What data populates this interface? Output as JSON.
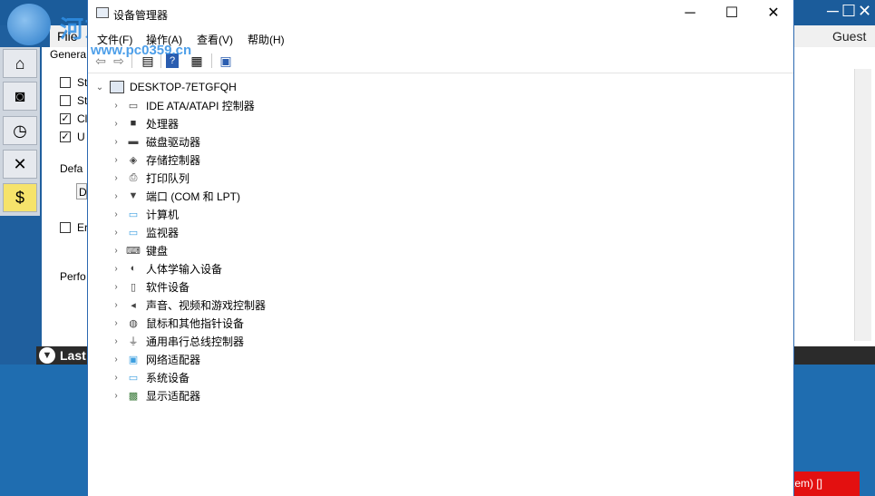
{
  "background_app": {
    "menu_file": "File",
    "tab_label": "Genera",
    "checks": [
      {
        "label": "St",
        "checked": false
      },
      {
        "label": "St",
        "checked": false
      },
      {
        "label": "Cl",
        "checked": true
      },
      {
        "label": "U",
        "checked": true
      }
    ],
    "default_label": "Defa",
    "dropdown_initial": "D",
    "enable_label": "Er",
    "perf_label": "Perfo",
    "guest_label": "Guest",
    "status_text": "Last",
    "red_task_text": "tem) []"
  },
  "watermark": {
    "title": "河东软件园",
    "url": "www.pc0359.cn"
  },
  "device_manager": {
    "title": "设备管理器",
    "controls": {
      "minimize": "─",
      "maximize": "☐",
      "close": "✕"
    },
    "menu": [
      "文件(F)",
      "操作(A)",
      "查看(V)",
      "帮助(H)"
    ],
    "root": "DESKTOP-7ETGFQH",
    "categories": [
      {
        "label": "IDE ATA/ATAPI 控制器",
        "icon": "ide-controller-icon"
      },
      {
        "label": "处理器",
        "icon": "processor-icon"
      },
      {
        "label": "磁盘驱动器",
        "icon": "disk-drive-icon"
      },
      {
        "label": "存储控制器",
        "icon": "storage-controller-icon"
      },
      {
        "label": "打印队列",
        "icon": "printer-icon"
      },
      {
        "label": "端口 (COM 和 LPT)",
        "icon": "port-icon"
      },
      {
        "label": "计算机",
        "icon": "computer-icon"
      },
      {
        "label": "监视器",
        "icon": "monitor-icon"
      },
      {
        "label": "键盘",
        "icon": "keyboard-icon"
      },
      {
        "label": "人体学输入设备",
        "icon": "hid-icon"
      },
      {
        "label": "软件设备",
        "icon": "software-device-icon"
      },
      {
        "label": "声音、视频和游戏控制器",
        "icon": "audio-icon"
      },
      {
        "label": "鼠标和其他指针设备",
        "icon": "mouse-icon"
      },
      {
        "label": "通用串行总线控制器",
        "icon": "usb-icon"
      },
      {
        "label": "网络适配器",
        "icon": "network-adapter-icon"
      },
      {
        "label": "系统设备",
        "icon": "system-device-icon"
      },
      {
        "label": "显示适配器",
        "icon": "display-adapter-icon"
      }
    ]
  }
}
